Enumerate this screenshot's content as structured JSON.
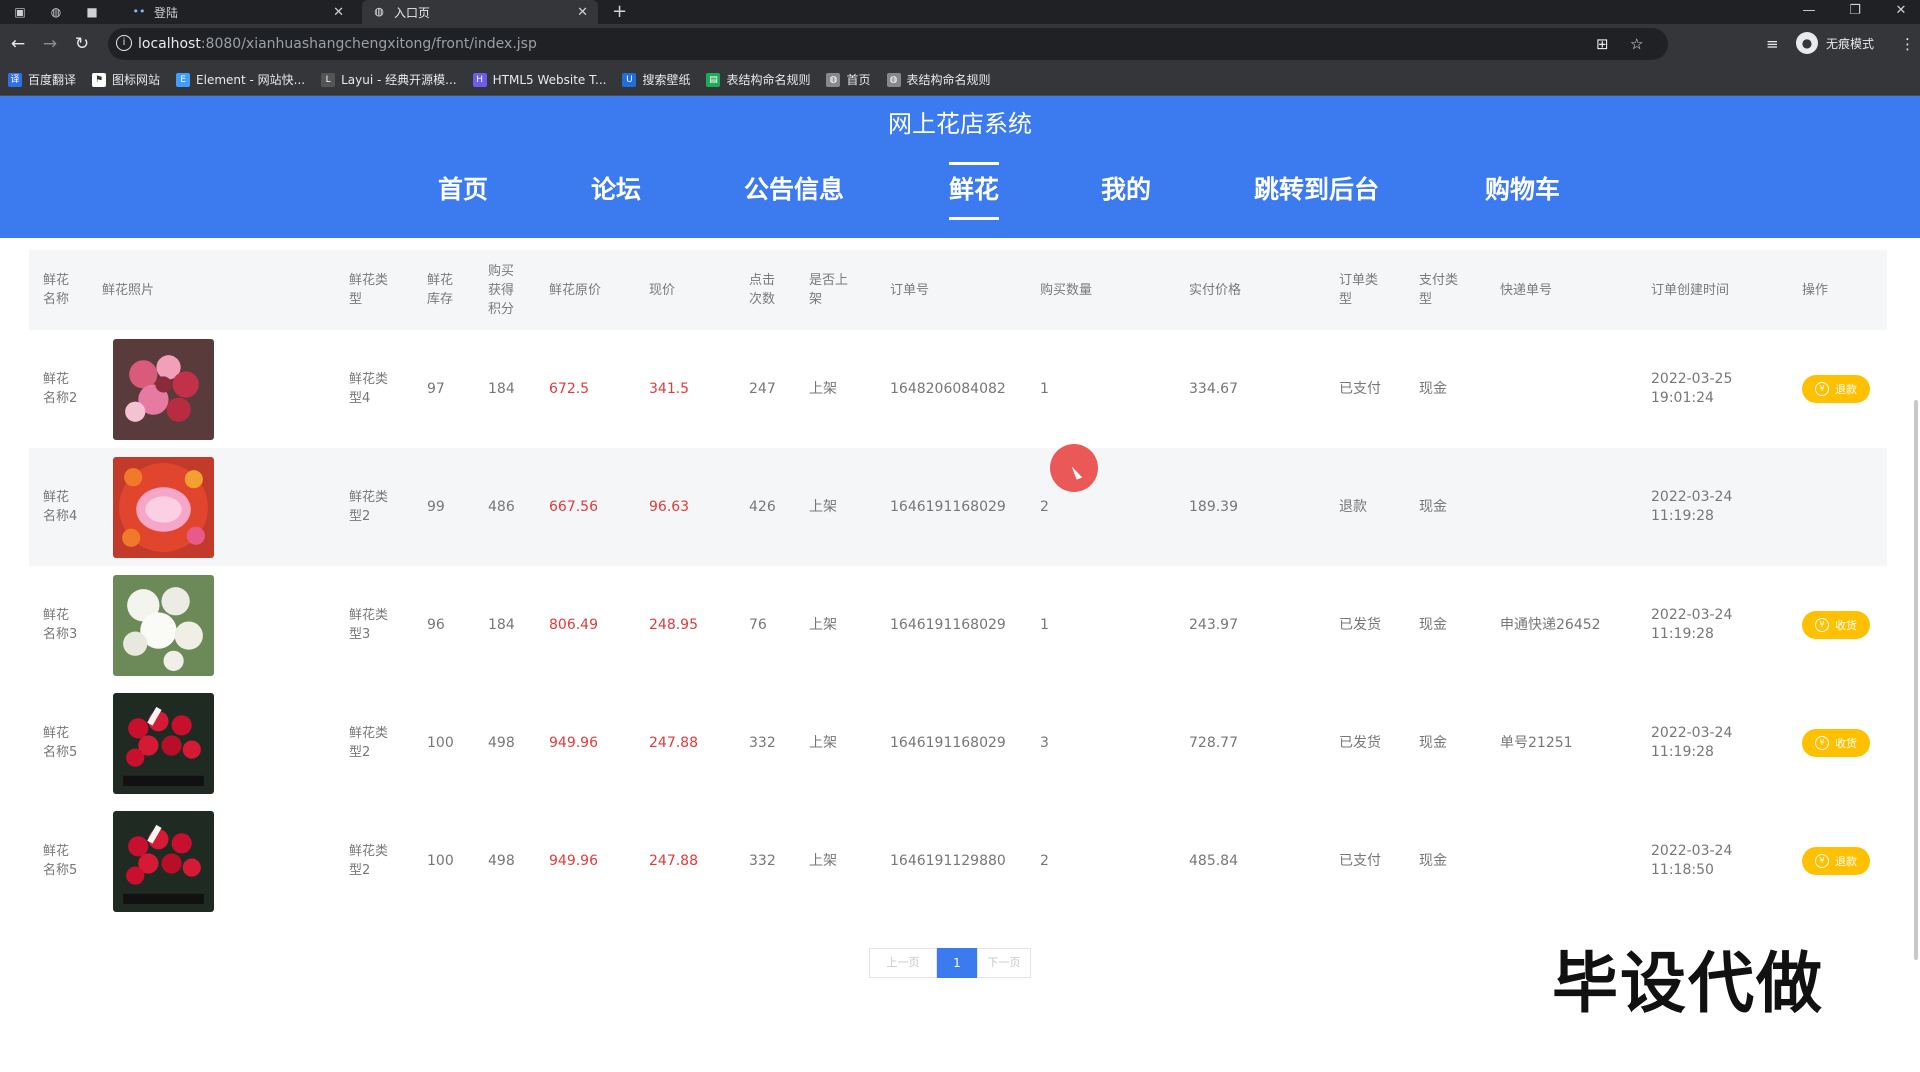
{
  "browser": {
    "tabs": [
      {
        "label": "登陆",
        "favicon": "dots-icon"
      },
      {
        "label": "入口页",
        "favicon": "globe-icon"
      }
    ],
    "url_host": "localhost",
    "url_rest": ":8080/xianhuashangchengxitong/front/index.jsp",
    "incognito_label": "无痕模式",
    "bookmarks": [
      {
        "label": "百度翻译",
        "color": "#2f6fea"
      },
      {
        "label": "图标网站",
        "color": "#333333"
      },
      {
        "label": "Element - 网站快...",
        "color": "#409eff"
      },
      {
        "label": "Layui - 经典开源模...",
        "color": "#555555"
      },
      {
        "label": "HTML5 Website T...",
        "color": "#6c5ce7"
      },
      {
        "label": "搜索壁纸",
        "color": "#1e6fd9"
      },
      {
        "label": "表结构命名规则",
        "color": "#1faa59"
      },
      {
        "label": "首页",
        "color": "#888888"
      },
      {
        "label": "表结构命名规则",
        "color": "#888888"
      }
    ]
  },
  "site": {
    "title": "网上花店系统",
    "nav": [
      "首页",
      "论坛",
      "公告信息",
      "鲜花",
      "我的",
      "跳转到后台",
      "购物车"
    ],
    "active_nav": "鲜花",
    "accent": "#3c7af0"
  },
  "table": {
    "headers": [
      "鲜花名称",
      "鲜花照片",
      "鲜花类型",
      "鲜花库存",
      "购买获得积分",
      "鲜花原价",
      "现价",
      "点击次数",
      "是否上架",
      "订单号",
      "购买数量",
      "实付价格",
      "订单类型",
      "支付类型",
      "快递单号",
      "订单创建时间",
      "操作"
    ],
    "rows": [
      {
        "name": "鲜花名称2",
        "type": "鲜花类型4",
        "stock": "97",
        "points": "184",
        "orig": "672.5",
        "price": "341.5",
        "clicks": "247",
        "shelf": "上架",
        "order_no": "1648206084082",
        "qty": "1",
        "paid": "334.67",
        "order_type": "已支付",
        "pay_type": "现金",
        "express": "",
        "date": "2022-03-25",
        "time": "19:01:24",
        "action": "退款",
        "photo": "mixed-bouquet"
      },
      {
        "name": "鲜花名称4",
        "type": "鲜花类型2",
        "stock": "99",
        "points": "486",
        "orig": "667.56",
        "price": "96.63",
        "clicks": "426",
        "shelf": "上架",
        "order_no": "1646191168029",
        "qty": "2",
        "paid": "189.39",
        "order_type": "退款",
        "pay_type": "现金",
        "express": "",
        "date": "2022-03-24",
        "time": "11:19:28",
        "action": "",
        "photo": "rose-ring"
      },
      {
        "name": "鲜花名称3",
        "type": "鲜花类型3",
        "stock": "96",
        "points": "184",
        "orig": "806.49",
        "price": "248.95",
        "clicks": "76",
        "shelf": "上架",
        "order_no": "1646191168029",
        "qty": "1",
        "paid": "243.97",
        "order_type": "已发货",
        "pay_type": "现金",
        "express": "申通快递26452",
        "date": "2022-03-24",
        "time": "11:19:28",
        "action": "收货",
        "photo": "white-flowers"
      },
      {
        "name": "鲜花名称5",
        "type": "鲜花类型2",
        "stock": "100",
        "points": "498",
        "orig": "949.96",
        "price": "247.88",
        "clicks": "332",
        "shelf": "上架",
        "order_no": "1646191168029",
        "qty": "3",
        "paid": "728.77",
        "order_type": "已发货",
        "pay_type": "现金",
        "express": "单号21251",
        "date": "2022-03-24",
        "time": "11:19:28",
        "action": "收货",
        "photo": "red-roses"
      },
      {
        "name": "鲜花名称5",
        "type": "鲜花类型2",
        "stock": "100",
        "points": "498",
        "orig": "949.96",
        "price": "247.88",
        "clicks": "332",
        "shelf": "上架",
        "order_no": "1646191129880",
        "qty": "2",
        "paid": "485.84",
        "order_type": "已支付",
        "pay_type": "现金",
        "express": "",
        "date": "2022-03-24",
        "time": "11:18:50",
        "action": "退款",
        "photo": "red-roses"
      }
    ]
  },
  "pager": {
    "prev": "上一页",
    "current": "1",
    "next": "下一页"
  },
  "watermark": "毕设代做",
  "colors": {
    "price_red": "#e23a3a",
    "action_yellow": "#ffc000"
  }
}
